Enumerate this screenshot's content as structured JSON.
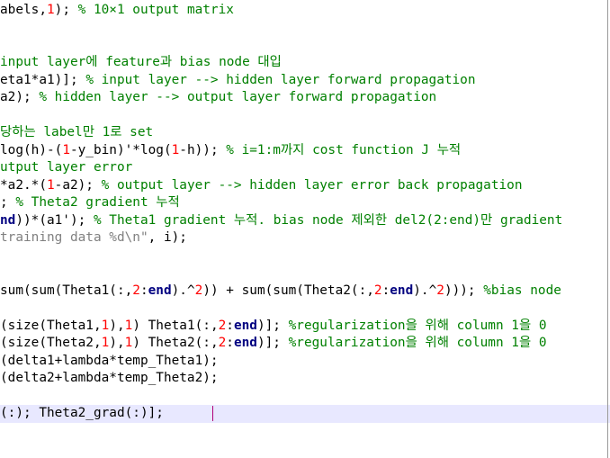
{
  "lines": [
    {
      "segments": [
        {
          "t": "abels,",
          "c": "code"
        },
        {
          "t": "1",
          "c": "num"
        },
        {
          "t": "); ",
          "c": "code"
        },
        {
          "t": "% 10×1 output matrix",
          "c": "cmt"
        }
      ]
    },
    {
      "segments": []
    },
    {
      "segments": []
    },
    {
      "segments": [
        {
          "t": "input layer에 feature과 bias node 대입",
          "c": "cmt"
        }
      ]
    },
    {
      "segments": [
        {
          "t": "eta1*a1)]; ",
          "c": "code"
        },
        {
          "t": "% input layer --> hidden layer forward propagation",
          "c": "cmt"
        }
      ]
    },
    {
      "segments": [
        {
          "t": "a2); ",
          "c": "code"
        },
        {
          "t": "% hidden layer --> output layer forward propagation",
          "c": "cmt"
        }
      ]
    },
    {
      "segments": []
    },
    {
      "segments": [
        {
          "t": "당하는 label만 1로 set",
          "c": "cmt"
        }
      ]
    },
    {
      "segments": [
        {
          "t": "log(h)-(",
          "c": "code"
        },
        {
          "t": "1",
          "c": "num"
        },
        {
          "t": "-y_bin)'*log(",
          "c": "code"
        },
        {
          "t": "1",
          "c": "num"
        },
        {
          "t": "-h)); ",
          "c": "code"
        },
        {
          "t": "% i=1:m까지 cost function J 누적",
          "c": "cmt"
        }
      ]
    },
    {
      "segments": [
        {
          "t": "utput layer error",
          "c": "cmt"
        }
      ]
    },
    {
      "segments": [
        {
          "t": "*a2.*(",
          "c": "code"
        },
        {
          "t": "1",
          "c": "num"
        },
        {
          "t": "-a2); ",
          "c": "code"
        },
        {
          "t": "% output layer --> hidden layer error back propagation",
          "c": "cmt"
        }
      ]
    },
    {
      "segments": [
        {
          "t": "; ",
          "c": "code"
        },
        {
          "t": "% Theta2 gradient 누적",
          "c": "cmt"
        }
      ]
    },
    {
      "segments": [
        {
          "t": "nd",
          "c": "kw"
        },
        {
          "t": "))*(a1'); ",
          "c": "code"
        },
        {
          "t": "% Theta1 gradient 누적. bias node 제외한 del2(2:end)만 gradient",
          "c": "cmt"
        }
      ]
    },
    {
      "segments": [
        {
          "t": "training data %d\\n\"",
          "c": "str"
        },
        {
          "t": ", i);",
          "c": "code"
        }
      ]
    },
    {
      "segments": []
    },
    {
      "segments": []
    },
    {
      "segments": [
        {
          "t": "sum(sum(Theta1(:,",
          "c": "code"
        },
        {
          "t": "2",
          "c": "num"
        },
        {
          "t": ":",
          "c": "code"
        },
        {
          "t": "end",
          "c": "kw"
        },
        {
          "t": ").^",
          "c": "code"
        },
        {
          "t": "2",
          "c": "num"
        },
        {
          "t": ")) + sum(sum(Theta2(:,",
          "c": "code"
        },
        {
          "t": "2",
          "c": "num"
        },
        {
          "t": ":",
          "c": "code"
        },
        {
          "t": "end",
          "c": "kw"
        },
        {
          "t": ").^",
          "c": "code"
        },
        {
          "t": "2",
          "c": "num"
        },
        {
          "t": "))); ",
          "c": "code"
        },
        {
          "t": "%bias node",
          "c": "cmt"
        }
      ]
    },
    {
      "segments": []
    },
    {
      "segments": [
        {
          "t": "(size(Theta1,",
          "c": "code"
        },
        {
          "t": "1",
          "c": "num"
        },
        {
          "t": "),",
          "c": "code"
        },
        {
          "t": "1",
          "c": "num"
        },
        {
          "t": ") Theta1(:,",
          "c": "code"
        },
        {
          "t": "2",
          "c": "num"
        },
        {
          "t": ":",
          "c": "code"
        },
        {
          "t": "end",
          "c": "kw"
        },
        {
          "t": ")]; ",
          "c": "code"
        },
        {
          "t": "%regularization을 위해 column 1을 0",
          "c": "cmt"
        }
      ]
    },
    {
      "segments": [
        {
          "t": "(size(Theta2,",
          "c": "code"
        },
        {
          "t": "1",
          "c": "num"
        },
        {
          "t": "),",
          "c": "code"
        },
        {
          "t": "1",
          "c": "num"
        },
        {
          "t": ") Theta2(:,",
          "c": "code"
        },
        {
          "t": "2",
          "c": "num"
        },
        {
          "t": ":",
          "c": "code"
        },
        {
          "t": "end",
          "c": "kw"
        },
        {
          "t": ")]; ",
          "c": "code"
        },
        {
          "t": "%regularization을 위해 column 1을 0",
          "c": "cmt"
        }
      ]
    },
    {
      "segments": [
        {
          "t": "(delta1+lambda*temp_Theta1);",
          "c": "code"
        }
      ]
    },
    {
      "segments": [
        {
          "t": "(delta2+lambda*temp_Theta2);",
          "c": "code"
        }
      ]
    },
    {
      "segments": []
    },
    {
      "segments": [
        {
          "t": "(:); Theta2_grad(:)];",
          "c": "code"
        }
      ]
    }
  ],
  "current_line_index": 23,
  "colors": {
    "code": "#000000",
    "number": "#ff0000",
    "keyword": "#000080",
    "comment": "#008000",
    "string": "#808080",
    "current_line_bg": "#e8e8ff",
    "caret": "#b0007a"
  }
}
